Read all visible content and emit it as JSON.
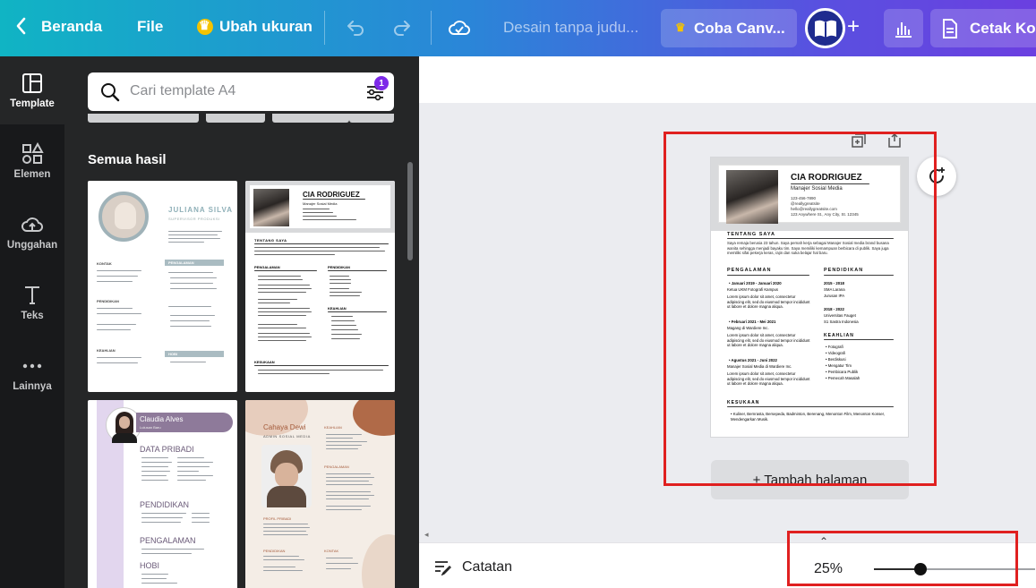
{
  "topbar": {
    "home": "Beranda",
    "file": "File",
    "resize": "Ubah ukuran",
    "title": "Desain tanpa judu...",
    "try_pro": "Coba Canv...",
    "print": "Cetak Kop"
  },
  "rail": {
    "items": [
      {
        "label": "Template",
        "icon": "template-icon"
      },
      {
        "label": "Elemen",
        "icon": "shapes-icon"
      },
      {
        "label": "Unggahan",
        "icon": "upload-cloud-icon"
      },
      {
        "label": "Teks",
        "icon": "text-icon"
      },
      {
        "label": "Lainnya",
        "icon": "more-icon"
      }
    ]
  },
  "panel": {
    "search_placeholder": "Cari template A4",
    "filter_count": "1",
    "section_title": "Semua hasil",
    "templates": [
      {
        "name": "JULIANA SILVA",
        "subtitle": "SUPERVISOR PRODUKSI",
        "sections": [
          "KONTAK",
          "PENDIDIKAN",
          "KEAHLIAN",
          "PENGALAMAN",
          "HOBI"
        ]
      },
      {
        "name": "CIA RODRIGUEZ",
        "subtitle": "Manajer Sosial Media",
        "sections": [
          "TENTANG SAYA",
          "PENGALAMAN",
          "PENDIDIKAN",
          "KEAHLIAN",
          "KESUKAAN"
        ]
      },
      {
        "name": "Claudia Alves",
        "subtitle": "Lulusan Baru",
        "sections": [
          "DATA PRIBADI",
          "PENDIDIKAN",
          "PENGALAMAN",
          "HOBI"
        ]
      },
      {
        "name": "Cahaya Dewi",
        "subtitle": "ADMIN SOSIAL MEDIA",
        "sections": [
          "KEAHLIAN",
          "PENGALAMAN",
          "PROFIL PRIBADI",
          "PENDIDIKAN",
          "KONTAK"
        ]
      }
    ]
  },
  "page": {
    "name": "CIA RODRIGUEZ",
    "role": "Manajer Sosial Media",
    "phone": "123-456-7890",
    "handle": "@reallygreatsite",
    "email": "hello@reallygreatsite.com",
    "address": "123 Anywhere St., Any City, St. 12345",
    "about_title": "TENTANG SAYA",
    "about_text": "Saya remaja berusia 23 tahun. Saya pernah kerja sebagai Manajer Sosial media brand busana wanita sehingga menjadi bayaku tim. Saya memiliki kemampuan berbicara di publik. Saya juga memiliki sifat pekerja keras, rajin dan suka belajar hal baru.",
    "experience_title": "PENGALAMAN",
    "experience": [
      {
        "period": "Januari 2019 - Januari 2020",
        "role": "Ketua UKM Fotografi Kampus"
      },
      {
        "period": "Februari 2021 - Mei 2021",
        "role": "Magang di Wardiere Inc."
      },
      {
        "period": "Agustus 2021 - Juni 2022",
        "role": "Manajer Sosial Media di Wardiere Inc."
      }
    ],
    "lorem": "Lorem ipsum dolor sit amet, consectetur adipiscing elit, sed do eiusmod tempor incididunt ut labore et dolore magna aliqua.",
    "education_title": "PENDIDIKAN",
    "education": [
      {
        "period": "2015 - 2018",
        "school": "SMA Larana",
        "major": "Jurusan IPA"
      },
      {
        "period": "2018 - 2022",
        "school": "Universitas Fauget",
        "major": "S1 Sastra Indonesia"
      }
    ],
    "skills_title": "KEAHLIAN",
    "skills": [
      "Fotografi",
      "Videografi",
      "Berdiskusi",
      "Mengatur Tim",
      "Pembicara Publik",
      "Pemecah Masalah"
    ],
    "hobbies_title": "KESUKAAN",
    "hobbies": "Kuliner, Bernrasta, Bersepeda, Badminton, Berenang, Menonton Film, Menonton Konser, Mendengarkan Musik."
  },
  "canvas": {
    "add_page": "+ Tambah halaman"
  },
  "bottombar": {
    "notes": "Catatan",
    "zoom": "25%",
    "zoom_fraction": 0.25
  },
  "colors": {
    "highlight": "#e02020",
    "accent": "#7d2ae8"
  }
}
